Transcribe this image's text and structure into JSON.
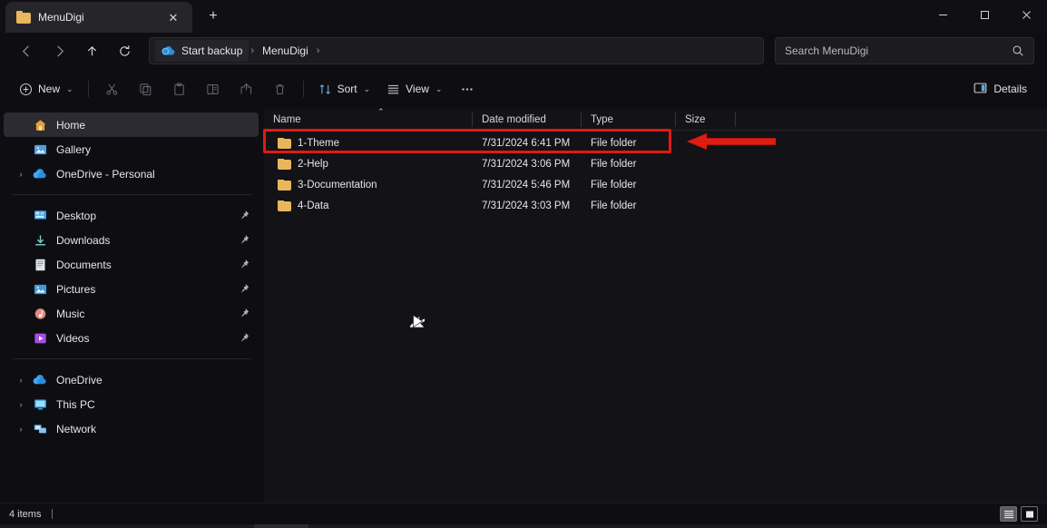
{
  "window": {
    "tab_title": "MenuDigi",
    "tab_close_label": "✕",
    "new_tab_label": "+",
    "minimize_label": "Minimize",
    "maximize_label": "Maximize",
    "close_label": "Close"
  },
  "nav": {
    "back_label": "Back",
    "forward_label": "Forward",
    "up_label": "Up",
    "refresh_label": "Refresh",
    "breadcrumbs": [
      {
        "label": "Start backup",
        "icon": "onedrive-cloud-icon",
        "highlighted": true
      },
      {
        "label": "MenuDigi",
        "icon": "",
        "highlighted": false
      }
    ],
    "separator": "›"
  },
  "search": {
    "placeholder": "Search MenuDigi",
    "value": "",
    "icon": "search-icon"
  },
  "toolbar": {
    "new_label": "New",
    "cut_label": "Cut",
    "copy_label": "Copy",
    "paste_label": "Paste",
    "rename_label": "Rename",
    "share_label": "Share",
    "delete_label": "Delete",
    "sort_label": "Sort",
    "view_label": "View",
    "more_label": "···",
    "details_label": "Details",
    "chevron": "⌄"
  },
  "sidebar": {
    "items": [
      {
        "label": "Home",
        "icon": "home-icon",
        "selected": true,
        "expander": false,
        "pin": false
      },
      {
        "label": "Gallery",
        "icon": "gallery-icon",
        "selected": false,
        "expander": false,
        "pin": false
      },
      {
        "label": "OneDrive - Personal",
        "icon": "onedrive-icon",
        "selected": false,
        "expander": true,
        "pin": false
      }
    ],
    "pinned": [
      {
        "label": "Desktop",
        "icon": "desktop-icon",
        "pin": true
      },
      {
        "label": "Downloads",
        "icon": "downloads-icon",
        "pin": true
      },
      {
        "label": "Documents",
        "icon": "documents-icon",
        "pin": true
      },
      {
        "label": "Pictures",
        "icon": "pictures-icon",
        "pin": true
      },
      {
        "label": "Music",
        "icon": "music-icon",
        "pin": true
      },
      {
        "label": "Videos",
        "icon": "videos-icon",
        "pin": true
      }
    ],
    "drives": [
      {
        "label": "OneDrive",
        "icon": "onedrive-icon",
        "expander": true
      },
      {
        "label": "This PC",
        "icon": "thispc-icon",
        "expander": true
      },
      {
        "label": "Network",
        "icon": "network-icon",
        "expander": true
      }
    ],
    "expander_glyph": "›",
    "pin_glyph": "pin-icon"
  },
  "filelist": {
    "columns": [
      {
        "key": "name",
        "label": "Name",
        "sorted": "asc"
      },
      {
        "key": "date",
        "label": "Date modified",
        "sorted": ""
      },
      {
        "key": "type",
        "label": "Type",
        "sorted": ""
      },
      {
        "key": "size",
        "label": "Size",
        "sorted": ""
      }
    ],
    "sort_arrow": "⌃",
    "rows": [
      {
        "name": "1-Theme",
        "date": "7/31/2024 6:41 PM",
        "type": "File folder",
        "size": "",
        "icon": "folder-icon",
        "annotated": true
      },
      {
        "name": "2-Help",
        "date": "7/31/2024 3:06 PM",
        "type": "File folder",
        "size": "",
        "icon": "folder-icon",
        "annotated": false
      },
      {
        "name": "3-Documentation",
        "date": "7/31/2024 5:46 PM",
        "type": "File folder",
        "size": "",
        "icon": "folder-icon",
        "annotated": false
      },
      {
        "name": "4-Data",
        "date": "7/31/2024 3:03 PM",
        "type": "File folder",
        "size": "",
        "icon": "folder-icon",
        "annotated": false
      }
    ]
  },
  "statusbar": {
    "item_count": "4 items",
    "details_view_label": "Details view",
    "large_icons_view_label": "Large icons view"
  },
  "annotations": {
    "highlight_color": "#e01b10",
    "arrow_color": "#e01b10",
    "arrow_direction": "left",
    "target_row": "1-Theme"
  },
  "colors": {
    "accent_folder": "#e9b75b",
    "window_bg": "#0e0e12",
    "pane_bg": "#131317",
    "selected_bg": "#2b2b31",
    "text_primary": "#e6e6eb"
  }
}
